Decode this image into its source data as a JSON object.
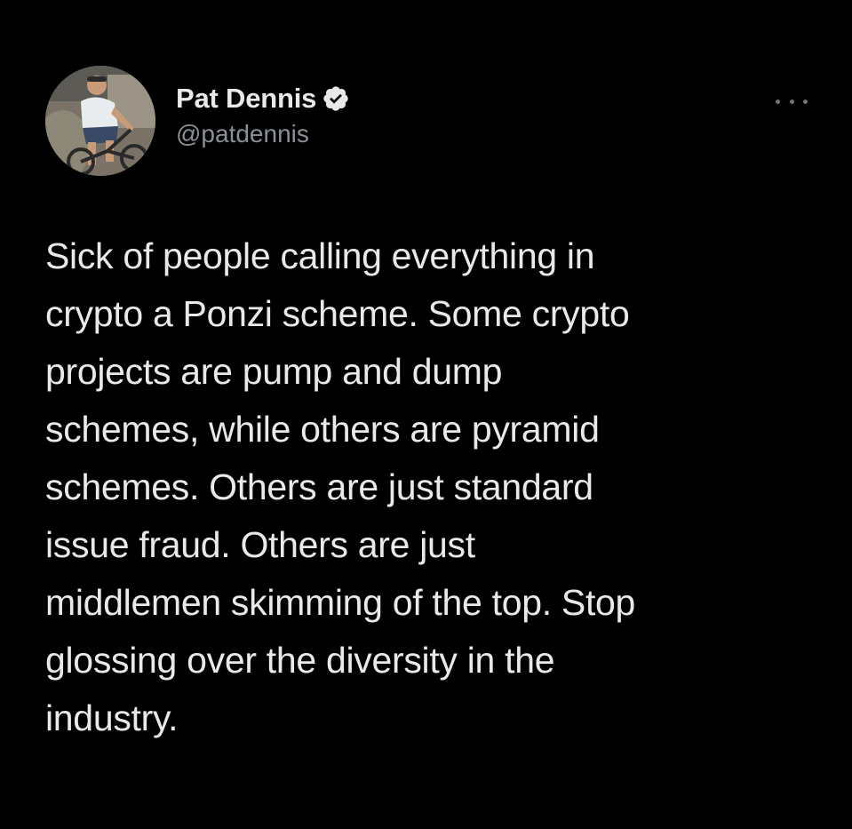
{
  "tweet": {
    "author": {
      "display_name": "Pat Dennis",
      "handle": "@patdennis",
      "verified": true,
      "avatar_icon": "avatar-photo"
    },
    "more_icon": "more-options-icon",
    "text": "Sick of people calling everything in\ncrypto a Ponzi scheme. Some crypto\nprojects are pump and dump\nschemes, while others are pyramid\nschemes. Others are just standard\nissue fraud. Others are just\nmiddlemen skimming of the top. Stop\nglossing over the diversity in the\nindustry."
  },
  "colors": {
    "background": "#000000",
    "text": "#e7e9ea",
    "secondary_text": "#8b9096",
    "verified_badge": "#e7e9ea"
  }
}
